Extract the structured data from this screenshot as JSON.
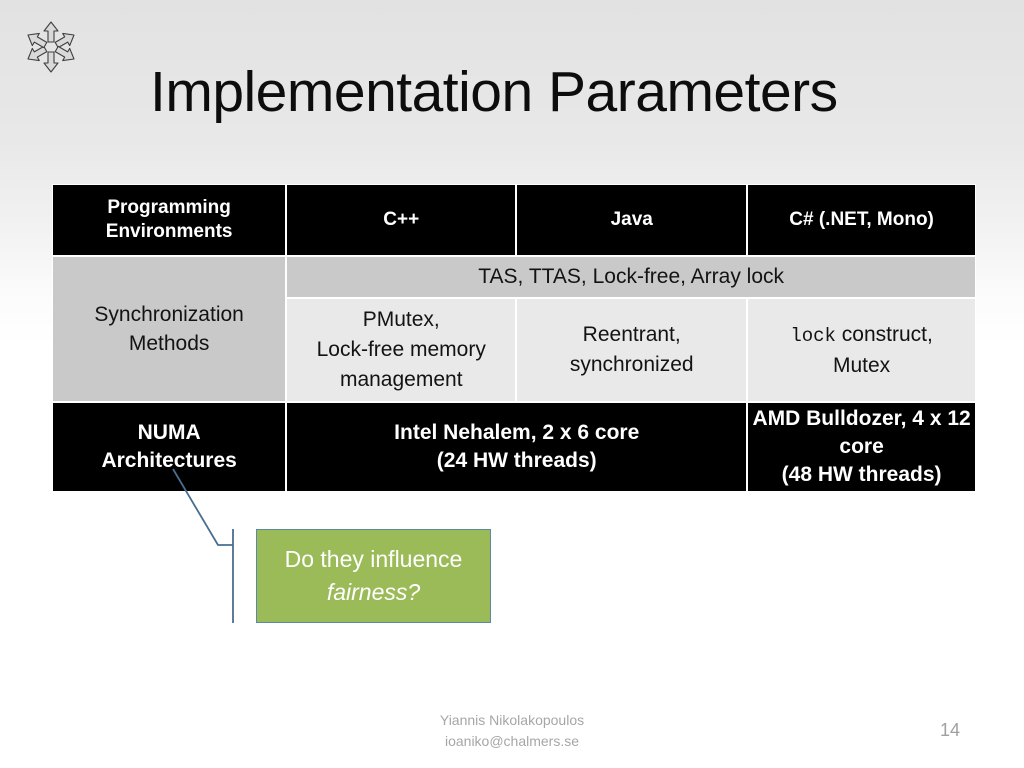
{
  "slide": {
    "title": "Implementation Parameters",
    "logo_icon": "chalmers-hexagon-arrows-logo",
    "page_number": "14",
    "footer_line1": "Yiannis Nikolakopoulos",
    "footer_line2": "ioaniko@chalmers.se",
    "colors": {
      "header_bg": "#000000",
      "row_label_bg": "#c9c9c9",
      "body_cell_bg": "#e9e9e9",
      "callout_bg": "#9BBB59",
      "callout_border": "#5B87A8",
      "connector_line": "#4A6E8F"
    }
  },
  "table": {
    "header": {
      "row_label": "Programming\nEnvironments",
      "row_label_line1": "Programming",
      "row_label_line2": "Environments",
      "columns": [
        "C++",
        "Java",
        "C# (.NET, Mono)"
      ]
    },
    "sync_row": {
      "label_line1": "Synchronization",
      "label_line2": "Methods",
      "shared_span": "TAS, TTAS, Lock-free, Array lock",
      "cells": [
        {
          "line1": "PMutex,",
          "line2": "Lock-free memory",
          "line3": "management"
        },
        {
          "line1": "Reentrant,",
          "line2": "synchronized",
          "line3": ""
        },
        {
          "mono": "lock",
          "line1": " construct,",
          "line2": "Mutex",
          "line3": ""
        }
      ]
    },
    "numa_row": {
      "label_line1": "NUMA",
      "label_line2": "Architectures",
      "cells": [
        {
          "line1": "Intel Nehalem, 2 x 6 core",
          "line2": "(24 HW threads)"
        },
        {
          "line1": "AMD Bulldozer, 4 x 12 core",
          "line2": "(48 HW threads)"
        }
      ]
    }
  },
  "callout": {
    "line1": "Do they influence",
    "line2": "fairness?"
  }
}
